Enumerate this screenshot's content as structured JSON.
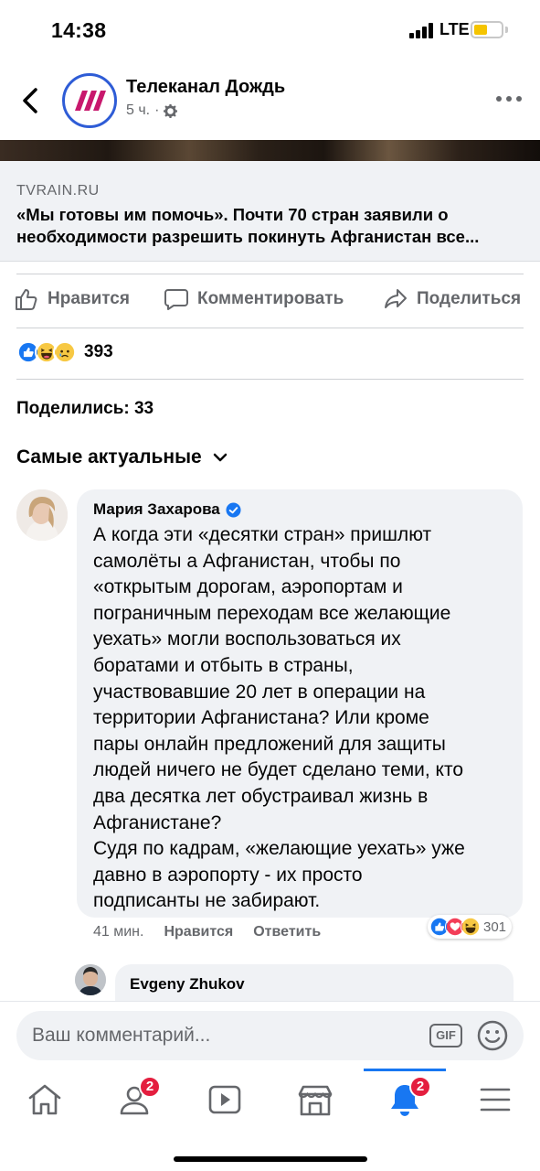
{
  "status_bar": {
    "time": "14:38",
    "network": "LTE"
  },
  "header": {
    "page_name": "Телеканал Дождь",
    "post_age": "5 ч."
  },
  "link_preview": {
    "domain": "TVRAIN.RU",
    "title": "«Мы готовы им помочь». Почти 70 стран заявили о необходимости разрешить покинуть Афганистан все..."
  },
  "actions": {
    "like": "Нравится",
    "comment": "Комментировать",
    "share": "Поделиться"
  },
  "reactions": {
    "count": "393",
    "types": [
      "like-icon",
      "haha-icon",
      "sad-icon"
    ]
  },
  "shares": "Поделились: 33",
  "sort": {
    "label": "Самые актуальные"
  },
  "comment": {
    "author": "Мария Захарова",
    "verified": true,
    "text": "А когда эти «десятки стран»  пришлют\nсамолёты а Афганистан, чтобы по\n«открытым дорогам, аэропортам и\nпограничным переходам  все желающие\nуехать» могли воспользоваться их\nборатами и отбыть в страны,\nучаствовавшие 20 лет в операции на\nтерритории Афганистана? Или кроме\nпары онлайн предложений для защиты\nлюдей ничего не будет сделано теми, кто\nдва десятка лет обустраивал жизнь в\nАфганистане?\nСудя по кадрам, «желающие уехать» уже\nдавно  в аэропорту - их просто\nподписанты не забирают.",
    "time": "41 мин.",
    "like": "Нравится",
    "reply": "Ответить",
    "reaction_count": "301",
    "reaction_types": [
      "like-icon",
      "love-icon",
      "haha-icon"
    ]
  },
  "reply": {
    "author": "Evgeny Zhukov"
  },
  "composer": {
    "placeholder": "Ваш комментарий...",
    "gif_label": "GIF"
  },
  "tabbar": {
    "tabs": [
      {
        "name": "home",
        "badge": ""
      },
      {
        "name": "friends",
        "badge": "2"
      },
      {
        "name": "watch",
        "badge": ""
      },
      {
        "name": "marketplace",
        "badge": ""
      },
      {
        "name": "notifications",
        "badge": "2",
        "active": true
      },
      {
        "name": "menu",
        "badge": ""
      }
    ]
  },
  "colors": {
    "accent": "#1877f2",
    "badge": "#e41e3f",
    "brand": "#2e5cd6",
    "brand_logo": "#c8186d"
  }
}
